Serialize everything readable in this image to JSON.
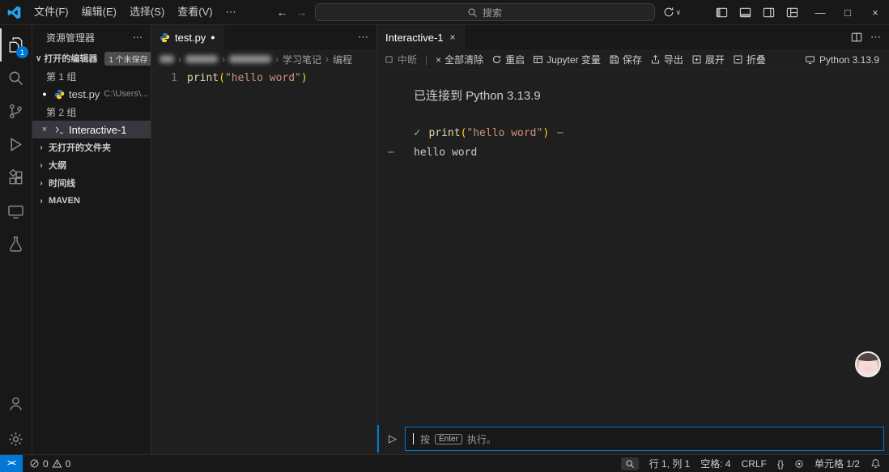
{
  "icons": {
    "more": "⋯",
    "chevron_right": "›",
    "chevron_down": "∨",
    "back": "←",
    "forward": "→",
    "close": "×",
    "dot": "●",
    "check": "✓",
    "play": "▷",
    "minimize": "—",
    "maximize": "□",
    "divider": "|"
  },
  "titlebar": {
    "menus": [
      "文件(F)",
      "编辑(E)",
      "选择(S)",
      "查看(V)"
    ],
    "search_placeholder": "搜索"
  },
  "activitybar": {
    "explorer_badge": "1"
  },
  "sidebar": {
    "title": "资源管理器",
    "open_editors_label": "打开的编辑器",
    "open_editors_badge": "1 个未保存",
    "group1_label": "第 1 组",
    "file1_name": "test.py",
    "file1_path": "C:\\Users\\...",
    "group2_label": "第 2 组",
    "file2_name": "Interactive-1",
    "sections": [
      "无打开的文件夹",
      "大纲",
      "时间线",
      "MAVEN"
    ]
  },
  "editor1": {
    "tab_name": "test.py",
    "breadcrumb": {
      "crumb1": "学习笔记",
      "crumb2": "编程"
    },
    "line_number": "1",
    "code": {
      "func": "print",
      "open_paren": "(",
      "string": "\"hello word\"",
      "close_paren": ")"
    }
  },
  "editor2": {
    "tab_name": "Interactive-1",
    "toolbar": {
      "interrupt": "中断",
      "clear_all": "全部清除",
      "restart": "重启",
      "variables": "Jupyter 变量",
      "save": "保存",
      "export": "导出",
      "expand": "展开",
      "collapse": "折叠",
      "kernel": "Python 3.13.9"
    },
    "connected_text": "已连接到 Python 3.13.9",
    "cell_code": {
      "func": "print",
      "open_paren": "(",
      "string": "\"hello word\"",
      "close_paren": ")"
    },
    "output_text": "hello word",
    "input_hint_prefix": "按",
    "input_hint_key": "Enter",
    "input_hint_suffix": "执行。"
  },
  "statusbar": {
    "remote_glyph": "><",
    "errors": "0",
    "warnings": "0",
    "line_col": "行 1, 列 1",
    "spaces": "空格: 4",
    "eol": "CRLF",
    "lang_braces": "{}",
    "cell_indicator": "单元格 1/2"
  }
}
